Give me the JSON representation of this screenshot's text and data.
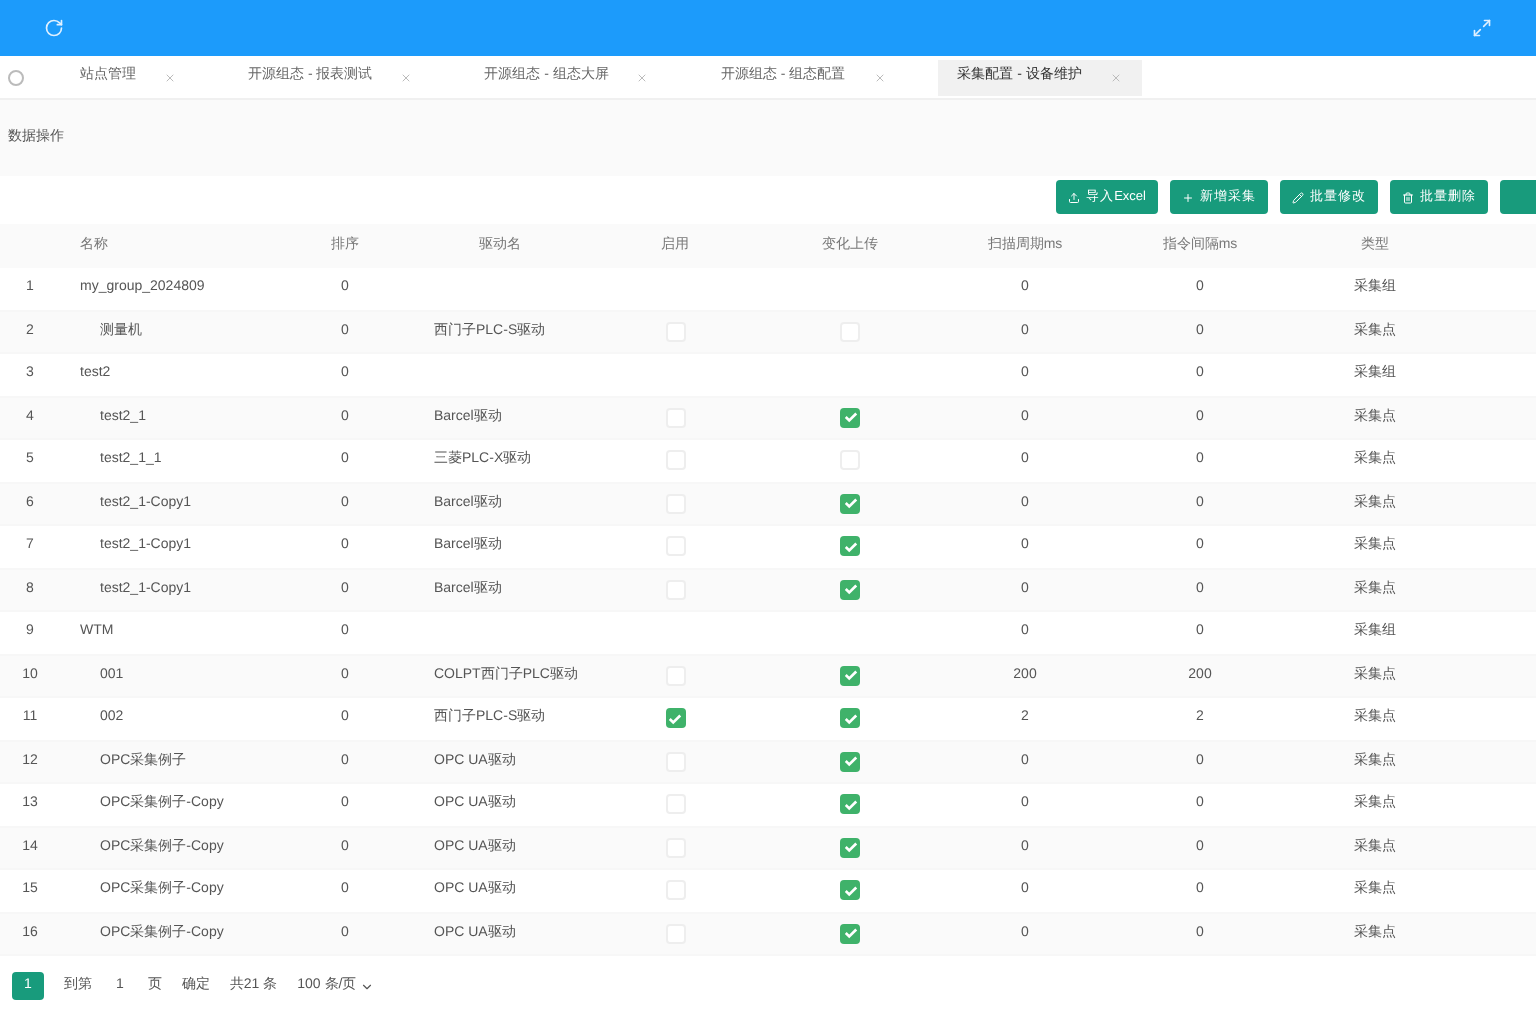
{
  "tabs": [
    {
      "label": "站点管理",
      "selected": false
    },
    {
      "label": "开源组态 - 报表测试",
      "selected": false
    },
    {
      "label": "开源组态 - 组态大屏",
      "selected": false
    },
    {
      "label": "开源组态 - 组态配置",
      "selected": false
    },
    {
      "label": "采集配置 - 设备维护",
      "selected": true
    }
  ],
  "section_title": "数据操作",
  "toolbar": [
    {
      "label": "导入Excel",
      "kind": "upload"
    },
    {
      "label": "新增采集",
      "kind": "add"
    },
    {
      "label": "批量修改",
      "kind": "edit"
    },
    {
      "label": "批量删除",
      "kind": "delete"
    }
  ],
  "table": {
    "columns": [
      "名称",
      "排序",
      "驱动名",
      "启用",
      "变化上传",
      "扫描周期ms",
      "指令间隔ms",
      "类型"
    ],
    "rows": [
      {
        "index": "1",
        "name": "my_group_2024809",
        "sort": "0",
        "driver": "",
        "scan": "0",
        "interval": "0",
        "type": "采集组",
        "kind": "group",
        "children": [
          {
            "index": "2",
            "name": "测量机",
            "sort": "0",
            "driver": "西门子PLC-S驱动",
            "enabled": false,
            "change_upload": false,
            "scan": "0",
            "interval": "0",
            "type": "采集点",
            "kind": "item"
          }
        ]
      },
      {
        "index": "3",
        "name": "test2",
        "sort": "0",
        "driver": "",
        "scan": "0",
        "interval": "0",
        "type": "采集组",
        "kind": "group",
        "children": [
          {
            "index": "4",
            "name": "test2_1",
            "sort": "0",
            "driver": "Barcel驱动",
            "enabled": false,
            "change_upload": true,
            "scan": "0",
            "interval": "0",
            "type": "采集点",
            "kind": "item"
          },
          {
            "index": "5",
            "name": "test2_1_1",
            "sort": "0",
            "driver": "三菱PLC-X驱动",
            "enabled": false,
            "change_upload": false,
            "scan": "0",
            "interval": "0",
            "type": "采集点",
            "kind": "item"
          },
          {
            "index": "6",
            "name": "test2_1-Copy1",
            "sort": "0",
            "driver": "Barcel驱动",
            "enabled": false,
            "change_upload": true,
            "scan": "0",
            "interval": "0",
            "type": "采集点",
            "kind": "item"
          },
          {
            "index": "7",
            "name": "test2_1-Copy1",
            "sort": "0",
            "driver": "Barcel驱动",
            "enabled": false,
            "change_upload": true,
            "scan": "0",
            "interval": "0",
            "type": "采集点",
            "kind": "item"
          },
          {
            "index": "8",
            "name": "test2_1-Copy1",
            "sort": "0",
            "driver": "Barcel驱动",
            "enabled": false,
            "change_upload": true,
            "scan": "0",
            "interval": "0",
            "type": "采集点",
            "kind": "item"
          }
        ]
      },
      {
        "index": "9",
        "name": "WTM",
        "sort": "0",
        "driver": "",
        "scan": "0",
        "interval": "0",
        "type": "采集组",
        "kind": "group",
        "children": [
          {
            "index": "10",
            "name": "001",
            "sort": "0",
            "driver": "COLPT西门子PLC驱动",
            "enabled": false,
            "change_upload": true,
            "scan": "200",
            "interval": "200",
            "type": "采集点",
            "kind": "item"
          },
          {
            "index": "11",
            "name": "002",
            "sort": "0",
            "driver": "西门子PLC-S驱动",
            "enabled": true,
            "change_upload": true,
            "scan": "2",
            "interval": "2",
            "type": "采集点",
            "kind": "item"
          },
          {
            "index": "12",
            "name": "OPC采集例子",
            "sort": "0",
            "driver": "OPC UA驱动",
            "enabled": false,
            "change_upload": true,
            "scan": "0",
            "interval": "0",
            "type": "采集点",
            "kind": "item"
          },
          {
            "index": "13",
            "name": "OPC采集例子-Copy",
            "sort": "0",
            "driver": "OPC UA驱动",
            "enabled": false,
            "change_upload": true,
            "scan": "0",
            "interval": "0",
            "type": "采集点",
            "kind": "item"
          },
          {
            "index": "14",
            "name": "OPC采集例子-Copy",
            "sort": "0",
            "driver": "OPC UA驱动",
            "enabled": false,
            "change_upload": true,
            "scan": "0",
            "interval": "0",
            "type": "采集点",
            "kind": "item"
          },
          {
            "index": "15",
            "name": "OPC采集例子-Copy",
            "sort": "0",
            "driver": "OPC UA驱动",
            "enabled": false,
            "change_upload": true,
            "scan": "0",
            "interval": "0",
            "type": "采集点",
            "kind": "item"
          },
          {
            "index": "16",
            "name": "OPC采集例子-Copy",
            "sort": "0",
            "driver": "OPC UA驱动",
            "enabled": false,
            "change_upload": true,
            "scan": "0",
            "interval": "0",
            "type": "采集点",
            "kind": "item"
          }
        ]
      }
    ]
  },
  "pagination": {
    "pages": [
      {
        "label": "1",
        "selected": true
      }
    ],
    "goto_label": "到第",
    "page_value": "1",
    "page_suffix": "页",
    "confirm": "确定",
    "total": "共21 条",
    "page_size": "100 条/页"
  }
}
